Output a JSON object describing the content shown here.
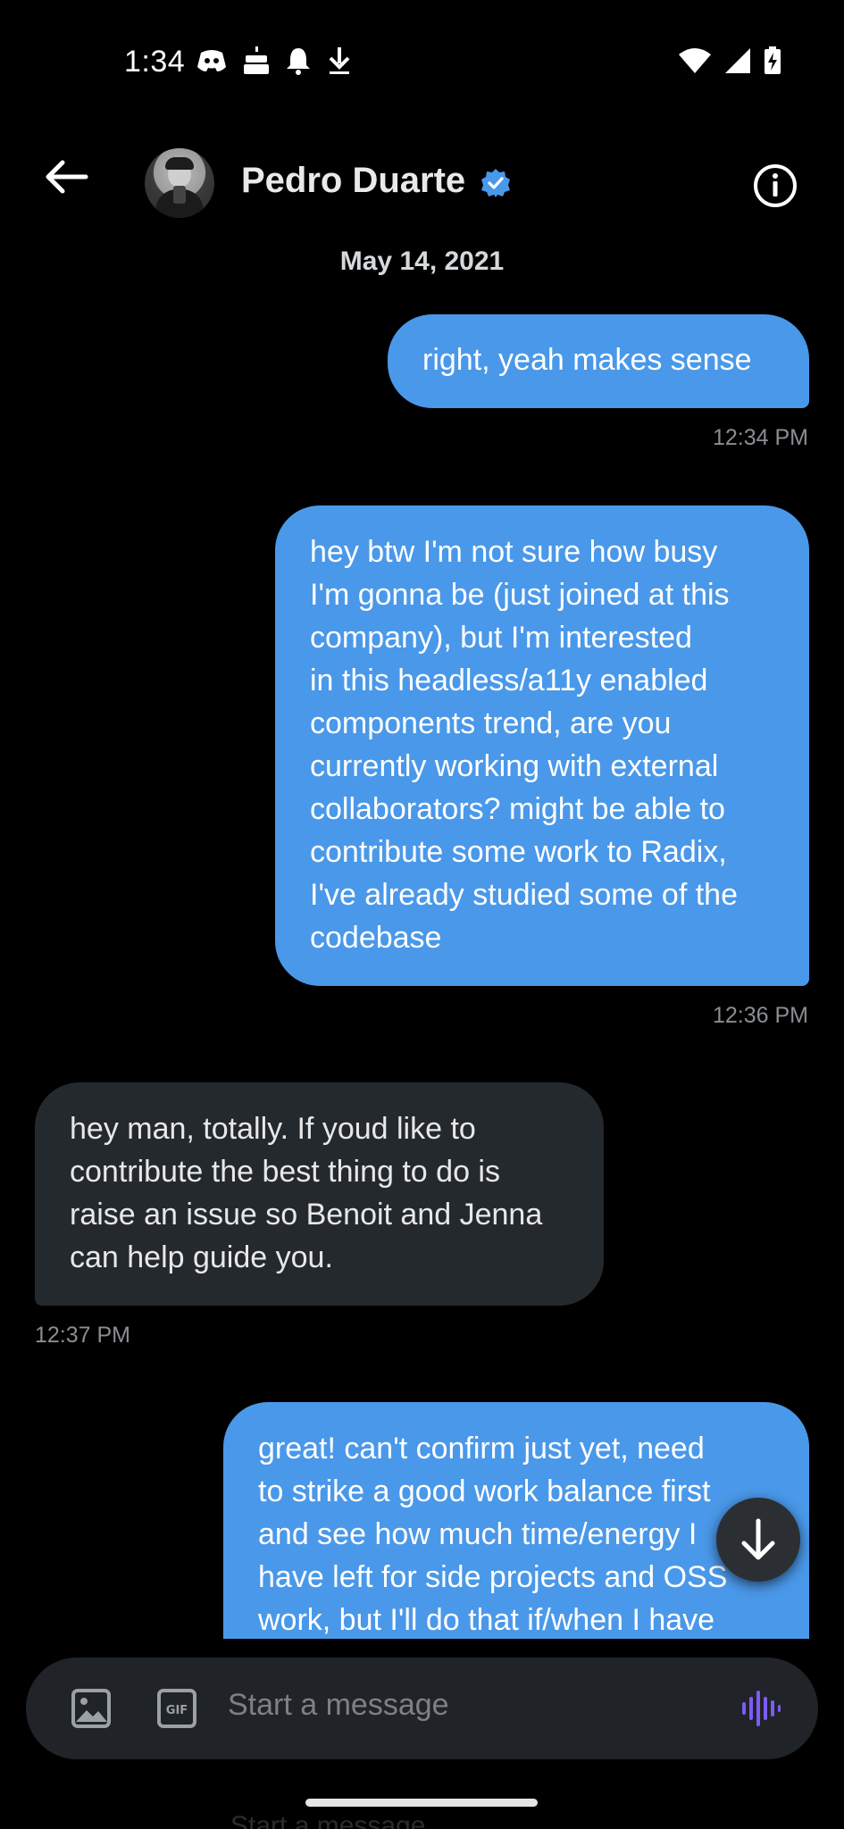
{
  "status_bar": {
    "time": "1:34",
    "left_icons": [
      "discord-icon",
      "cake-icon",
      "notification-bell-icon",
      "download-icon"
    ],
    "right_icons": [
      "wifi-icon",
      "signal-icon",
      "battery-charging-icon"
    ]
  },
  "header": {
    "contact_name": "Pedro Duarte",
    "verified": true,
    "accent": "#4a98e9"
  },
  "date_separator": "May 14, 2021",
  "messages": [
    {
      "direction": "outgoing",
      "lines": [
        "right, yeah makes sense"
      ],
      "time": "12:34 PM"
    },
    {
      "direction": "outgoing",
      "lines": [
        "hey btw I'm not sure how busy",
        "I'm gonna be (just joined at this",
        "company), but I'm interested",
        "in this headless/a11y enabled",
        "components trend, are you",
        "currently working with external",
        "collaborators? might be able to",
        "contribute some work to Radix,",
        "I've already studied some of the",
        "codebase"
      ],
      "time": "12:36 PM"
    },
    {
      "direction": "incoming",
      "lines": [
        "hey man, totally. If youd like to",
        "contribute the best thing to do is",
        "raise an issue so Benoit and Jenna",
        "can help guide you."
      ],
      "time": "12:37 PM"
    },
    {
      "direction": "outgoing",
      "lines": [
        "great! can't confirm just yet, need",
        "to strike a good work balance first",
        "and see how much time/energy I",
        "have left for side projects and OSS",
        "work, but I'll do that if/when I have"
      ],
      "time": ""
    }
  ],
  "composer": {
    "placeholder": "Start a message",
    "ghost_placeholder": "Start a message",
    "voice_color": "#7b5cf5"
  }
}
